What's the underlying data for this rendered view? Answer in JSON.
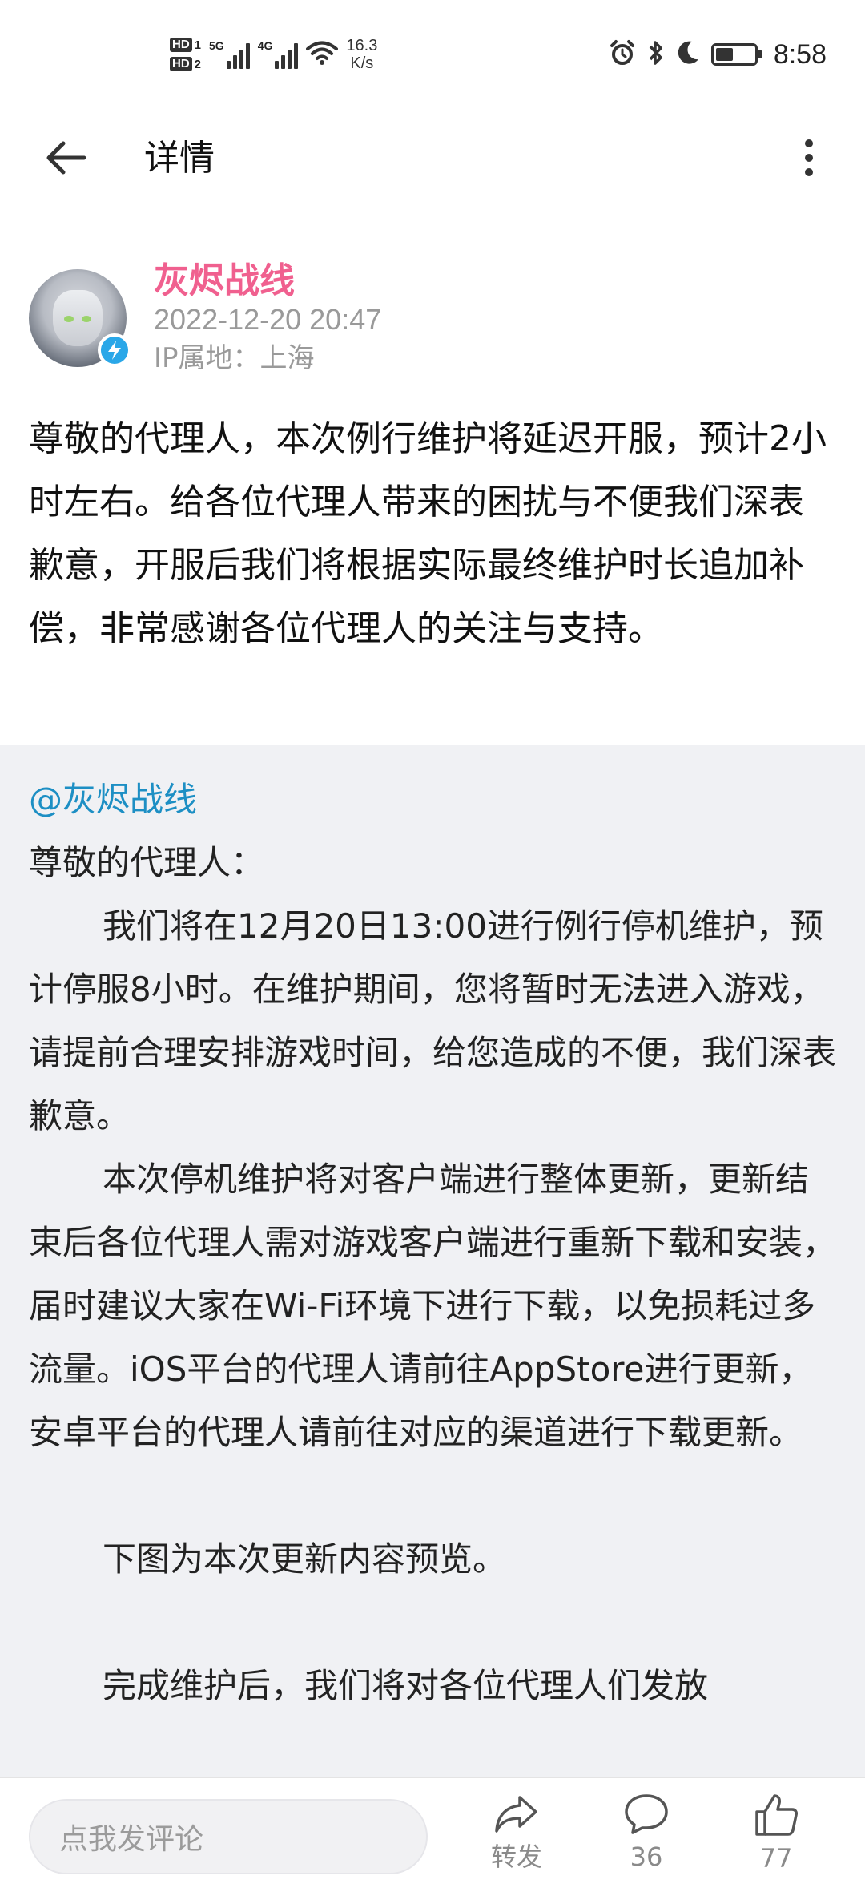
{
  "status_bar": {
    "hd1": "HD",
    "hd1_num": "1",
    "hd2": "HD",
    "hd2_num": "2",
    "net1": "5G",
    "net2": "4G",
    "speed_value": "16.3",
    "speed_unit": "K/s",
    "time": "8:58",
    "battery_level": 0.45,
    "icons": [
      "alarm-icon",
      "bluetooth-icon",
      "moon-icon",
      "battery-icon",
      "wifi-icon",
      "signal-icon"
    ]
  },
  "header": {
    "title": "详情"
  },
  "post": {
    "author": "灰烬战线",
    "date": "2022-12-20 20:47",
    "ip": "IP属地：上海",
    "text": "尊敬的代理人，本次例行维护将延迟开服，预计2小时左右。给各位代理人带来的困扰与不便我们深表歉意，开服后我们将根据实际最终维护时长追加补偿，非常感谢各位代理人的关注与支持。"
  },
  "repost": {
    "mention": "@灰烬战线",
    "greeting": "尊敬的代理人：",
    "para1": "我们将在12月20日13:00进行例行停机维护，预计停服8小时。在维护期间，您将暂时无法进入游戏，请提前合理安排游戏时间，给您造成的不便，我们深表歉意。",
    "para2": "本次停机维护将对客户端进行整体更新，更新结束后各位代理人需对游戏客户端进行重新下载和安装，届时建议大家在Wi-Fi环境下进行下载，以免损耗过多流量。iOS平台的代理人请前往AppStore进行更新，安卓平台的代理人请前往对应的渠道进行下载更新。",
    "para3": "下图为本次更新内容预览。",
    "para4": "完成维护后，我们将对各位代理人们发放"
  },
  "bottom_bar": {
    "comment_placeholder": "点我发评论",
    "repost_label": "转发",
    "comment_count": "36",
    "like_count": "77"
  },
  "colors": {
    "author_name": "#f0608f",
    "mention": "#1d8fc4",
    "repost_bg": "#f0f1f4",
    "secondary_text": "#9a9a9a"
  }
}
